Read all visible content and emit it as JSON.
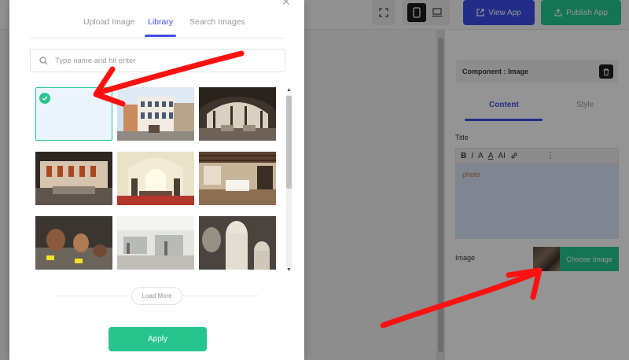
{
  "topbar": {
    "view_app_label": "View App",
    "publish_app_label": "Publish App",
    "accent_color": "#3d4fe8",
    "success_color": "#24c991"
  },
  "panel": {
    "component_header": "Component : Image",
    "tabs": [
      {
        "label": "Content",
        "active": true
      },
      {
        "label": "Style",
        "active": false
      }
    ],
    "title_label": "Title",
    "toolbar": {
      "bold": "B",
      "italic": "I",
      "font_size": "A",
      "font_color": "A",
      "ai": "AI",
      "more": "⋮"
    },
    "editor_text": "photo",
    "image_label": "Image",
    "choose_image_label": "Choose Image"
  },
  "modal": {
    "tabs": [
      {
        "label": "Upload Image",
        "active": false
      },
      {
        "label": "Library",
        "active": true
      },
      {
        "label": "Search Images",
        "active": false
      }
    ],
    "search": {
      "placeholder": "Type name and hit enter",
      "value": ""
    },
    "images": [
      {
        "scene": "blank",
        "selected": true
      },
      {
        "scene": "building-facade",
        "selected": false
      },
      {
        "scene": "arched-hall",
        "selected": false
      },
      {
        "scene": "gallery-room",
        "selected": false
      },
      {
        "scene": "arched-corridor",
        "selected": false
      },
      {
        "scene": "beamed-hall",
        "selected": false
      },
      {
        "scene": "pottery-display",
        "selected": false
      },
      {
        "scene": "exhibit-cases",
        "selected": false
      },
      {
        "scene": "sarcophagi",
        "selected": false
      }
    ],
    "load_more_label": "Load More",
    "apply_label": "Apply",
    "selected_color": "#27c48e"
  },
  "annotations": {
    "color": "#ff0000",
    "arrows": [
      "points-to-selected-image",
      "points-to-choose-image"
    ]
  }
}
